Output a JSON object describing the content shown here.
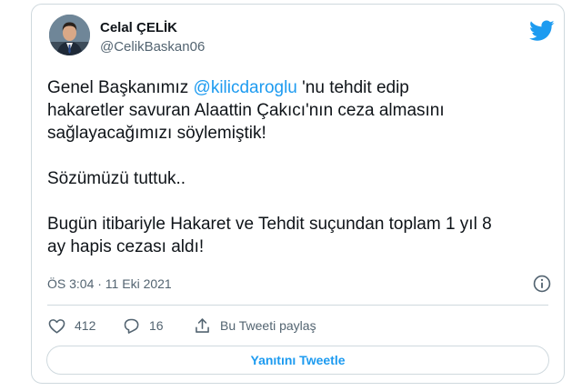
{
  "author": {
    "name": "Celal ÇELİK",
    "handle": "@CelikBaskan06"
  },
  "tweet": {
    "line1_before": "Genel Başkanımız ",
    "mention": "@kilicdaroglu",
    "line1_after": " 'nu tehdit edip",
    "line2": "hakaretler savuran Alaattin Çakıcı'nın ceza almasını",
    "line3": "sağlayacağımızı söylemiştik!",
    "line4": "Sözümüzü tuttuk..",
    "line5": "Bugün itibariyle Hakaret ve Tehdit suçundan toplam 1 yıl 8",
    "line6": "ay hapis cezası aldı!"
  },
  "meta": {
    "timestamp": "ÖS 3:04 · 11 Eki 2021"
  },
  "actions": {
    "likes": "412",
    "replies": "16",
    "share_label": "Bu Tweeti paylaş"
  },
  "reply_button": "Yanıtını Tweetle",
  "colors": {
    "twitter_blue": "#1d9bf0",
    "secondary_text": "#536471",
    "border": "#cfd9de"
  },
  "icons": [
    "twitter-bird-icon",
    "info-icon",
    "heart-icon",
    "reply-bubble-icon",
    "share-icon"
  ]
}
